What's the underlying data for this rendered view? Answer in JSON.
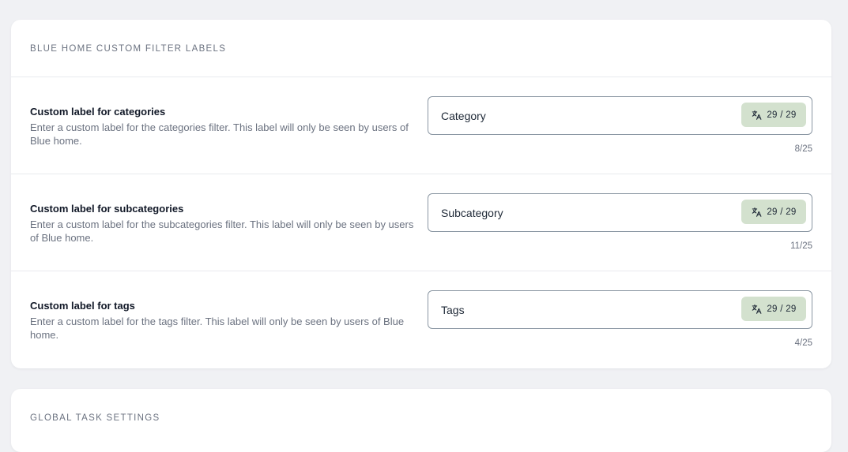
{
  "sections": {
    "filters": {
      "title": "BLUE HOME CUSTOM FILTER LABELS",
      "rows": [
        {
          "label": "Custom label for categories",
          "description": "Enter a custom label for the categories filter. This label will only be seen by users of Blue home.",
          "value": "Category",
          "translations": "29 / 29",
          "counter": "8/25"
        },
        {
          "label": "Custom label for subcategories",
          "description": "Enter a custom label for the subcategories filter. This label will only be seen by users of Blue home.",
          "value": "Subcategory",
          "translations": "29 / 29",
          "counter": "11/25"
        },
        {
          "label": "Custom label for tags",
          "description": "Enter a custom label for the tags filter. This label will only be seen by users of Blue home.",
          "value": "Tags",
          "translations": "29 / 29",
          "counter": "4/25"
        }
      ]
    },
    "global": {
      "title": "GLOBAL TASK SETTINGS"
    }
  },
  "colors": {
    "badge_bg": "#d3e1ce",
    "border": "#8b97a3",
    "page_bg": "#f0f1f4"
  },
  "icons": {
    "translate": "translate-icon"
  }
}
